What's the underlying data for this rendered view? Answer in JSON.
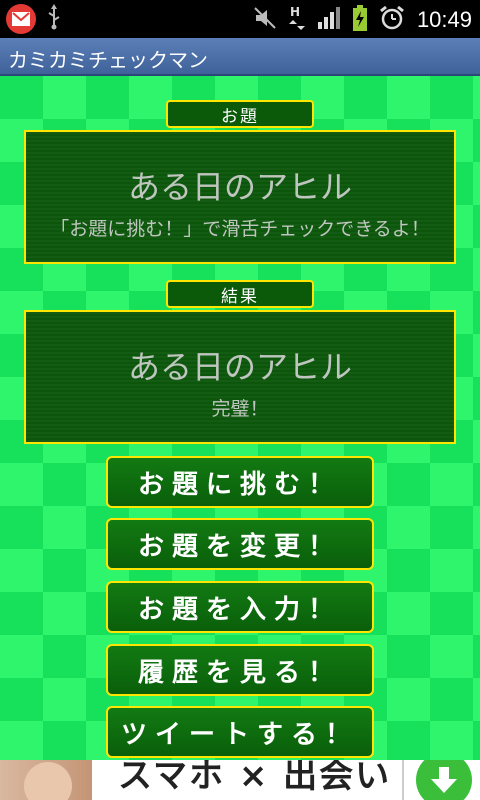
{
  "status_bar": {
    "time": "10:49",
    "icons": [
      "mail-icon",
      "usb-icon",
      "mute-icon",
      "hsdpa-signal-icon",
      "signal-bars-icon",
      "battery-charging-icon",
      "alarm-icon"
    ]
  },
  "app": {
    "title": "カミカミチェックマン"
  },
  "topic": {
    "tab_label": "お題",
    "title": "ある日のアヒル",
    "hint": "「お題に挑む！」で滑舌チェックできるよ！"
  },
  "result": {
    "tab_label": "結果",
    "title": "ある日のアヒル",
    "verdict": "完璧！"
  },
  "buttons": {
    "challenge": "お題に挑む！",
    "change": "お題を変更！",
    "input": "お題を入力！",
    "history": "履歴を見る！",
    "tweet": "ツイートする！"
  },
  "ad": {
    "text": "スマホ × 出会い",
    "icon": "download-arrow-icon"
  },
  "colors": {
    "background_green": "#17e05a",
    "board_green": "#0c560c",
    "border_yellow": "#ffe600",
    "titlebar_blue": "#4a6ea6"
  }
}
